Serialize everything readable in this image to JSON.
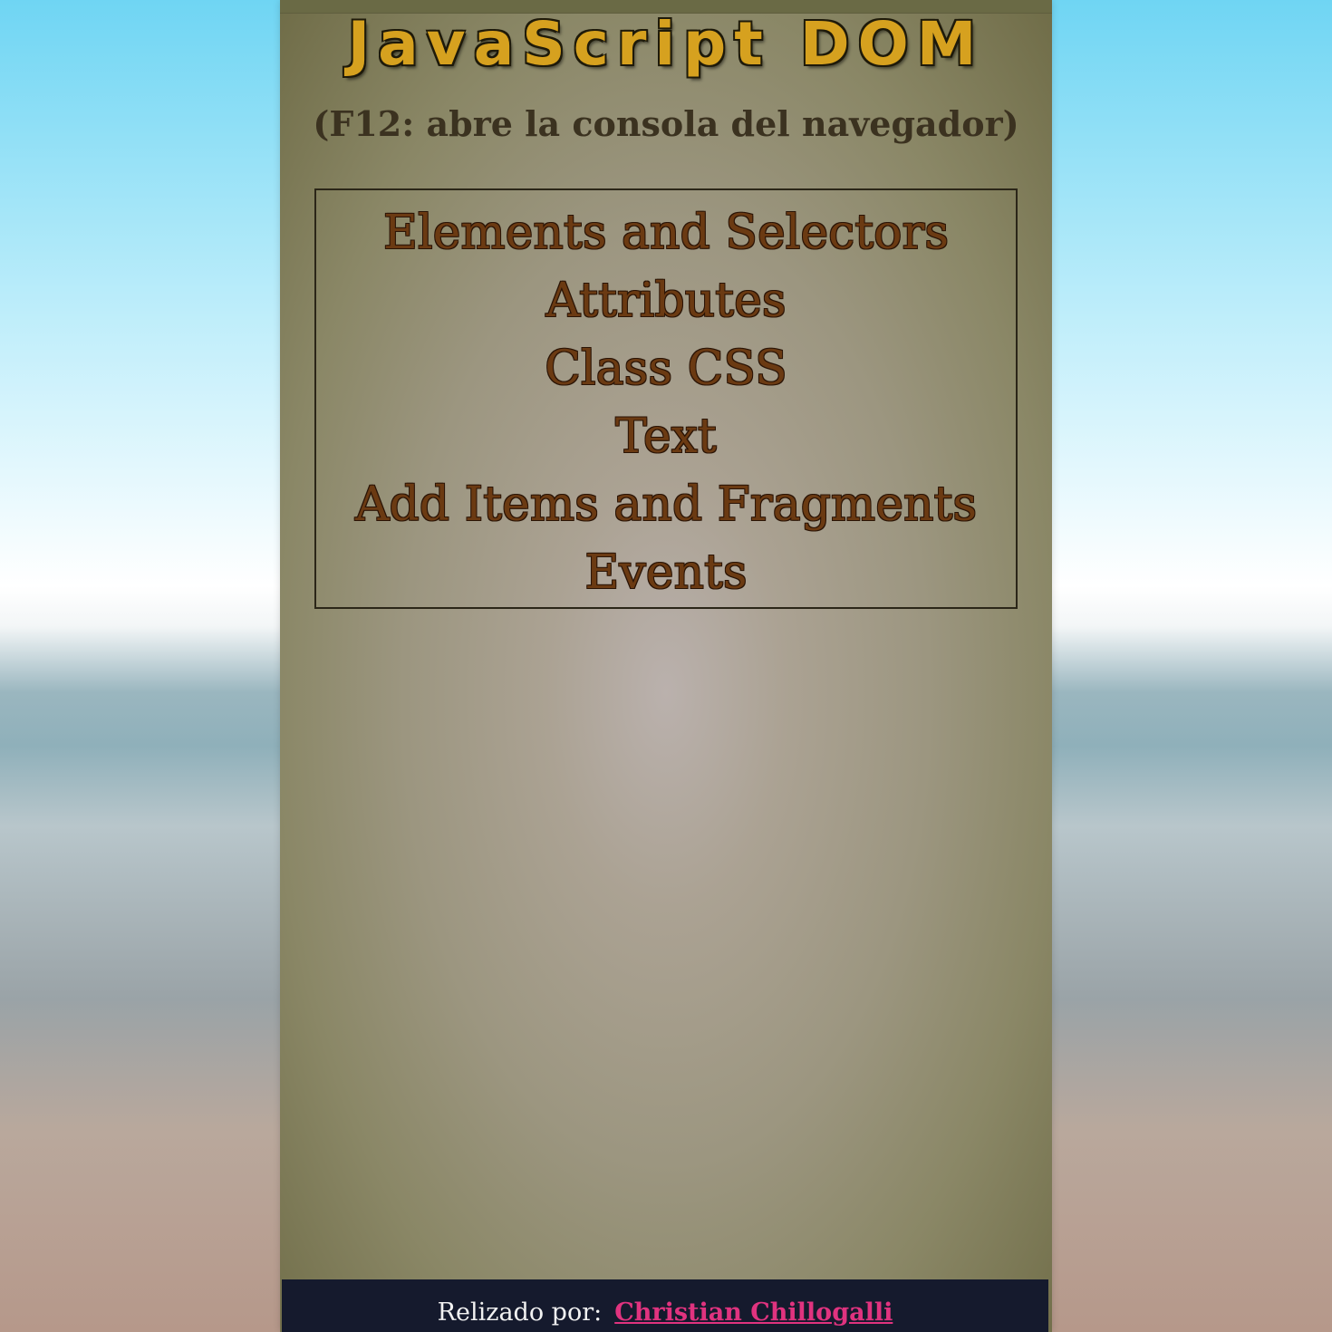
{
  "header": {
    "title": "JavaScript DOM",
    "subtitle": "(F12: abre la consola del navegador)"
  },
  "menu": {
    "items": [
      {
        "label": "Elements and Selectors"
      },
      {
        "label": "Attributes"
      },
      {
        "label": "Class CSS"
      },
      {
        "label": "Text"
      },
      {
        "label": "Add Items and Fragments"
      },
      {
        "label": "Events"
      }
    ]
  },
  "footer": {
    "credit_label": "Relizado por:",
    "author_link": "Christian Chillogalli"
  },
  "colors": {
    "title": "#d6a11f",
    "menu_text": "#6b3a12",
    "footer_bg": "#151a2d",
    "footer_link": "#e0337f"
  }
}
